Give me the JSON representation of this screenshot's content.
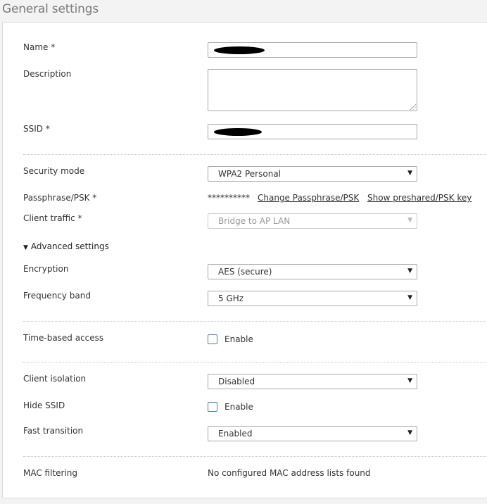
{
  "page": {
    "title": "General settings"
  },
  "form": {
    "name": {
      "label": "Name *",
      "value": ""
    },
    "description": {
      "label": "Description",
      "value": ""
    },
    "ssid": {
      "label": "SSID *",
      "value": ""
    },
    "security_mode": {
      "label": "Security mode",
      "value": "WPA2 Personal"
    },
    "passphrase": {
      "label": "Passphrase/PSK *",
      "masked": "**********",
      "change_link": "Change Passphrase/PSK",
      "show_link": "Show preshared/PSK key"
    },
    "client_traffic": {
      "label": "Client traffic *",
      "value": "Bridge to AP LAN",
      "disabled": true
    },
    "advanced": {
      "toggle_label": "Advanced settings",
      "expanded": true,
      "encryption": {
        "label": "Encryption",
        "value": "AES (secure)"
      },
      "frequency_band": {
        "label": "Frequency band",
        "value": "5 GHz"
      }
    },
    "time_based_access": {
      "label": "Time-based access",
      "checkbox_label": "Enable",
      "checked": false
    },
    "client_isolation": {
      "label": "Client isolation",
      "value": "Disabled"
    },
    "hide_ssid": {
      "label": "Hide SSID",
      "checkbox_label": "Enable",
      "checked": false
    },
    "fast_transition": {
      "label": "Fast transition",
      "value": "Enabled"
    },
    "mac_filtering": {
      "label": "MAC filtering",
      "value": "No configured MAC address lists found"
    }
  },
  "icons": {
    "dropdown": "triangle-down-icon",
    "expand": "triangle-down-icon"
  },
  "colors": {
    "checkbox_border": "#4d7fb5",
    "panel_bg": "#ffffff",
    "page_bg": "#f3f3f3"
  }
}
